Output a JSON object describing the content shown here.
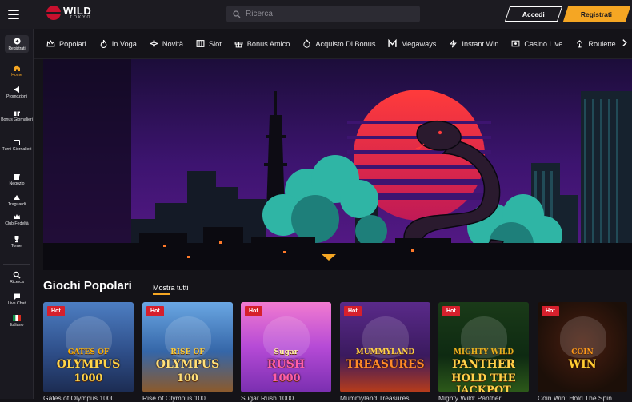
{
  "header": {
    "logo_word": "WILD",
    "logo_sub": "TOKYO",
    "search_placeholder": "Ricerca",
    "login_label": "Accedi",
    "register_label": "Registrati"
  },
  "sidebar": {
    "register_label": "Registrati",
    "items": [
      {
        "label": "Home",
        "icon": "home-icon",
        "active": true
      },
      {
        "label": "Promozioni",
        "icon": "megaphone-icon"
      },
      {
        "label": "Bonus Giornalieri",
        "icon": "gift-icon"
      },
      {
        "label": "Turni Giornalieri",
        "icon": "calendar-icon"
      },
      {
        "label": "Negozio",
        "icon": "shop-icon"
      },
      {
        "label": "Traguardi",
        "icon": "target-icon"
      },
      {
        "label": "Club Fedeltà",
        "icon": "crown-icon"
      },
      {
        "label": "Tornei",
        "icon": "trophy-icon"
      },
      {
        "label": "Ricerca",
        "icon": "search-icon"
      },
      {
        "label": "Live Chat",
        "icon": "chat-icon"
      },
      {
        "label": "Italiano",
        "icon": "italy-flag-icon"
      }
    ]
  },
  "categories": [
    {
      "label": "Popolari",
      "icon": "crown-icon"
    },
    {
      "label": "In Voga",
      "icon": "flame-icon"
    },
    {
      "label": "Novità",
      "icon": "sparkle-icon"
    },
    {
      "label": "Slot",
      "icon": "slot-icon"
    },
    {
      "label": "Bonus Amico",
      "icon": "gift-box-icon"
    },
    {
      "label": "Acquisto Di Bonus",
      "icon": "star-bag-icon"
    },
    {
      "label": "Megaways",
      "icon": "m-logo-icon"
    },
    {
      "label": "Instant Win",
      "icon": "lightning-icon"
    },
    {
      "label": "Casino Live",
      "icon": "live-icon"
    },
    {
      "label": "Roulette",
      "icon": "roulette-icon"
    },
    {
      "label": "",
      "icon": "chevron-right-icon"
    }
  ],
  "section": {
    "title": "Giochi Popolari",
    "show_all": "Mostra tutti"
  },
  "games": [
    {
      "name": "Gates of Olympus 1000",
      "badge": "Hot",
      "art_line1": "GATES OF",
      "art_line2": "OLYMPUS",
      "art_line3": "1000"
    },
    {
      "name": "Rise of Olympus 100",
      "badge": "Hot",
      "art_line1": "RISE OF",
      "art_line2": "OLYMPUS",
      "art_line3": "100"
    },
    {
      "name": "Sugar Rush 1000",
      "badge": "Hot",
      "art_line1": "Sugar",
      "art_line2": "RUSH",
      "art_line3": "1000"
    },
    {
      "name": "Mummyland Treasures",
      "badge": "Hot",
      "art_line1": "MUMMYLAND",
      "art_line2": "TREASURES",
      "art_line3": ""
    },
    {
      "name": "Mighty Wild: Panther",
      "badge": "Hot",
      "art_line1": "MIGHTY WILD",
      "art_line2": "PANTHER",
      "art_line3": "HOLD THE JACKPOT"
    },
    {
      "name": "Coin Win: Hold The Spin",
      "badge": "Hot",
      "art_line1": "COIN",
      "art_line2": "WIN",
      "art_line3": ""
    }
  ],
  "colors": {
    "accent": "#f5a623",
    "hot": "#d6202c",
    "background": "#141318",
    "sidebar": "#1a1920"
  }
}
